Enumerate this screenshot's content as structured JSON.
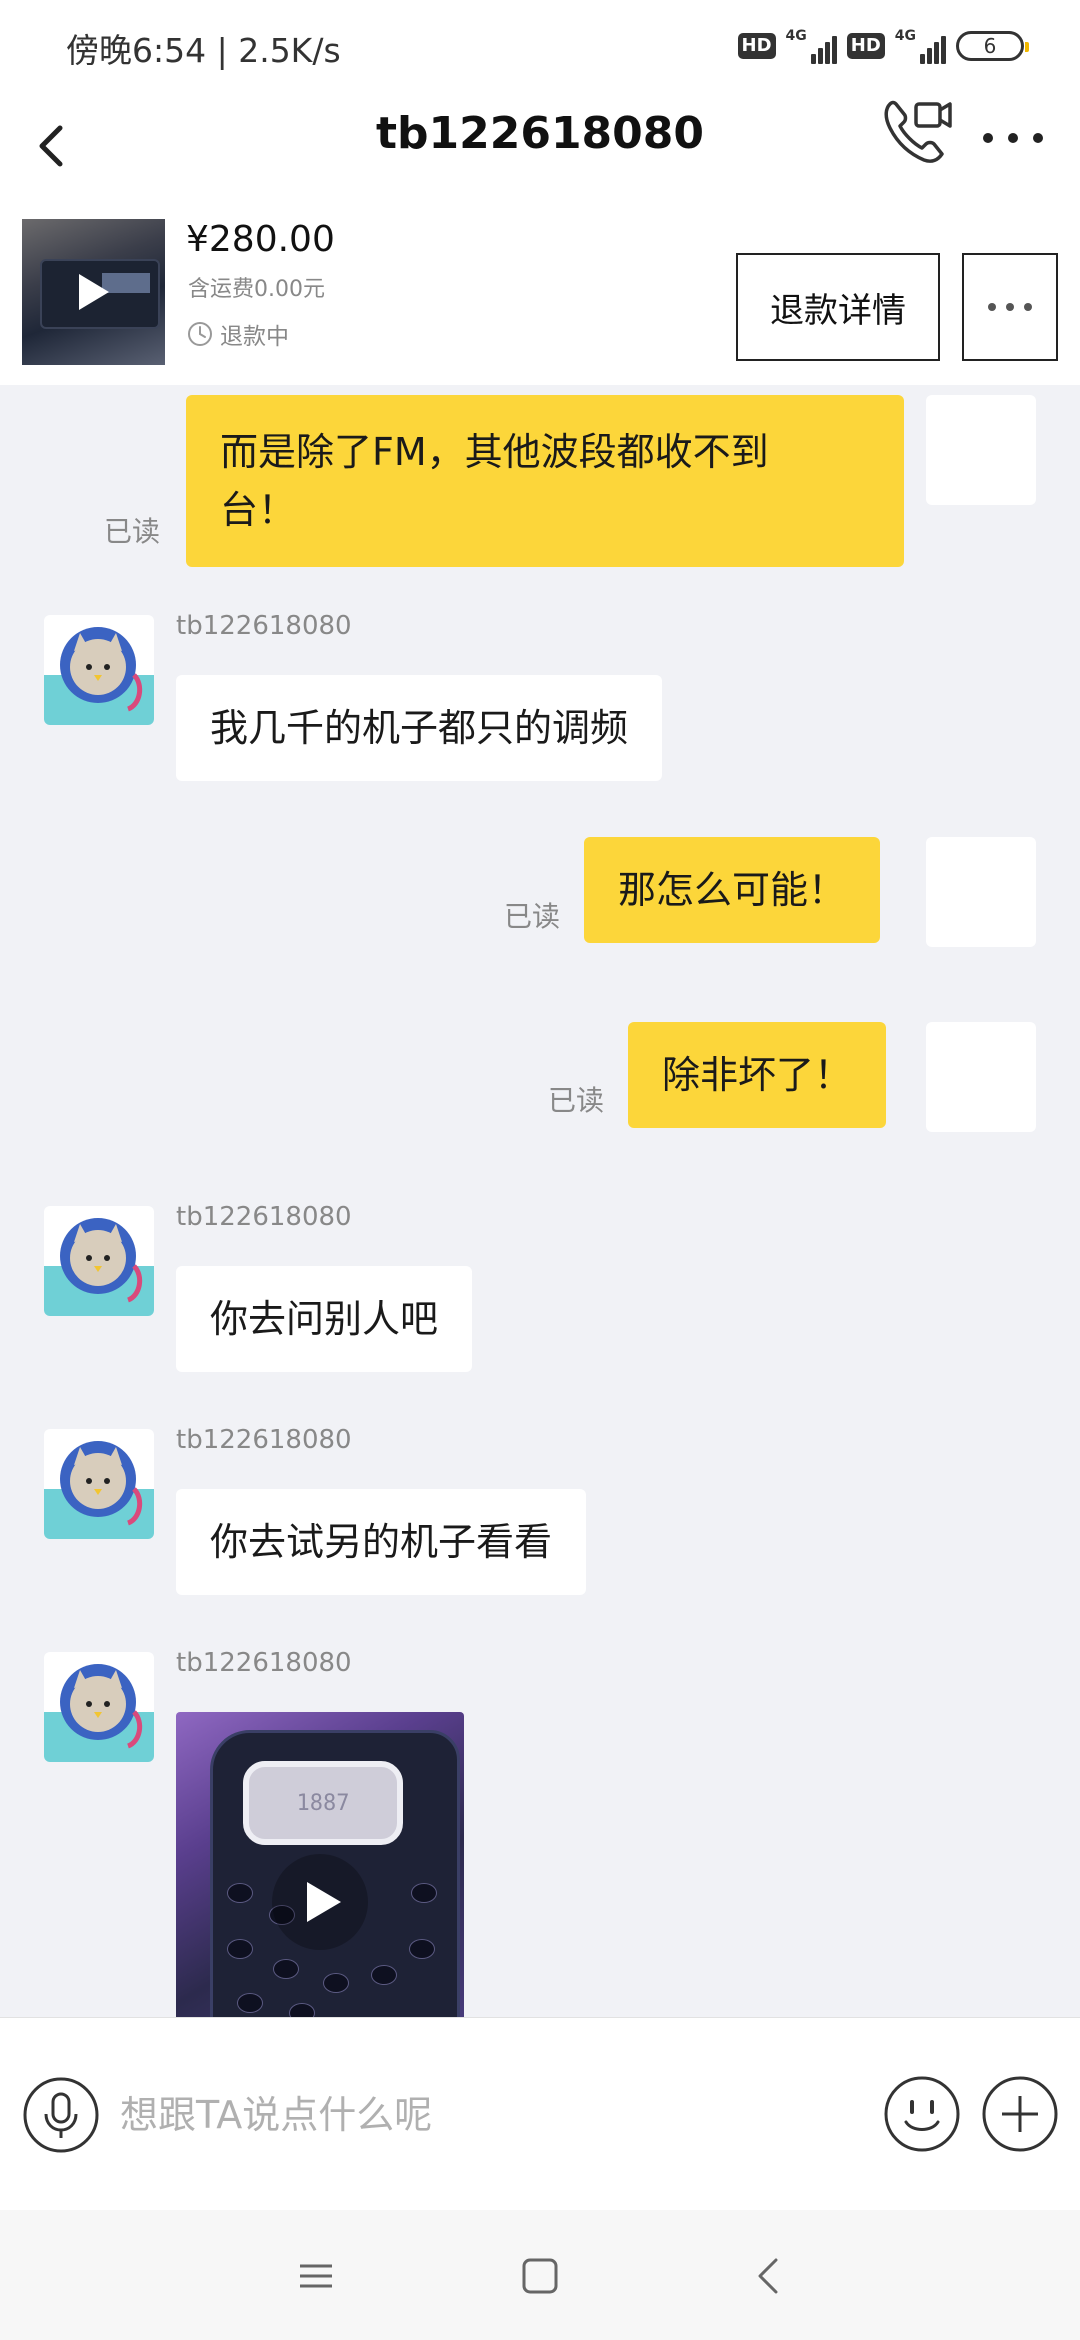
{
  "status_bar": {
    "time": "傍晚6:54 | 2.5K/s",
    "hd1": "HD",
    "net1": "4G",
    "hd2": "HD",
    "net2": "4G",
    "battery": "6"
  },
  "header": {
    "title": "tb122618080",
    "icons": {
      "back": "back-arrow-icon",
      "call": "video-call-icon",
      "more": "more-dots-icon"
    }
  },
  "product": {
    "price": "¥280.00",
    "shipping": "含运费0.00元",
    "status": "退款中",
    "refund_button": "退款详情"
  },
  "messages": [
    {
      "side": "out",
      "text": "而是除了FM，其他波段都收不到台！",
      "line1": "而是除了FM，其他波段都收不到",
      "line2": "台！",
      "read": "已读"
    },
    {
      "side": "in",
      "sender": "tb122618080",
      "text": "我几千的机子都只的调频"
    },
    {
      "side": "out",
      "text": "那怎么可能！",
      "read": "已读"
    },
    {
      "side": "out",
      "text": "除非坏了！",
      "read": "已读"
    },
    {
      "side": "in",
      "sender": "tb122618080",
      "text": "你去问别人吧"
    },
    {
      "side": "in",
      "sender": "tb122618080",
      "text": "你去试另的机子看看"
    },
    {
      "side": "in",
      "sender": "tb122618080",
      "type": "video",
      "lcd_text": "1887"
    }
  ],
  "input": {
    "placeholder": "想跟TA说点什么呢"
  },
  "colors": {
    "outgoing_bubble": "#fcd63a",
    "chat_background": "#f1f2f6",
    "incoming_bubble": "#ffffff"
  }
}
